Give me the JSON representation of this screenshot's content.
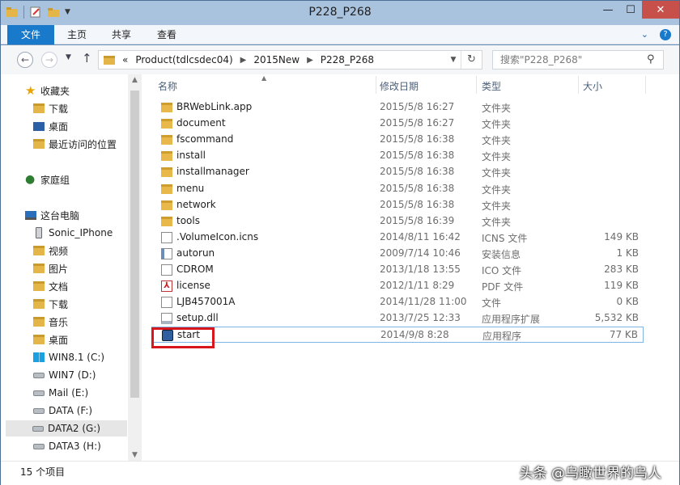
{
  "window": {
    "title": "P228_P268"
  },
  "ribbon": {
    "tabs": [
      "文件",
      "主页",
      "共享",
      "查看"
    ]
  },
  "address": {
    "overflow": "«",
    "crumbs": [
      "Product(tdlcsdec04)",
      "2015New",
      "P228_P268"
    ]
  },
  "search": {
    "placeholder": "搜索\"P228_P268\""
  },
  "nav": {
    "favorites": {
      "label": "收藏夹",
      "items": [
        "下载",
        "桌面",
        "最近访问的位置"
      ]
    },
    "homegroup": "家庭组",
    "thispc": {
      "label": "这台电脑",
      "items": [
        "Sonic_IPhone",
        "视频",
        "图片",
        "文档",
        "下载",
        "音乐",
        "桌面",
        "WIN8.1 (C:)",
        "WIN7 (D:)",
        "Mail (E:)",
        "DATA (F:)",
        "DATA2 (G:)",
        "DATA3 (H:)"
      ]
    }
  },
  "columns": {
    "name": "名称",
    "date": "修改日期",
    "type": "类型",
    "size": "大小"
  },
  "files": [
    {
      "name": "BRWebLink.app",
      "date": "2015/5/8 16:27",
      "type": "文件夹",
      "size": "",
      "icon": "folder"
    },
    {
      "name": "document",
      "date": "2015/5/8 16:27",
      "type": "文件夹",
      "size": "",
      "icon": "folder"
    },
    {
      "name": "fscommand",
      "date": "2015/5/8 16:38",
      "type": "文件夹",
      "size": "",
      "icon": "folder"
    },
    {
      "name": "install",
      "date": "2015/5/8 16:38",
      "type": "文件夹",
      "size": "",
      "icon": "folder"
    },
    {
      "name": "installmanager",
      "date": "2015/5/8 16:38",
      "type": "文件夹",
      "size": "",
      "icon": "folder"
    },
    {
      "name": "menu",
      "date": "2015/5/8 16:38",
      "type": "文件夹",
      "size": "",
      "icon": "folder"
    },
    {
      "name": "network",
      "date": "2015/5/8 16:38",
      "type": "文件夹",
      "size": "",
      "icon": "folder"
    },
    {
      "name": "tools",
      "date": "2015/5/8 16:39",
      "type": "文件夹",
      "size": "",
      "icon": "folder"
    },
    {
      "name": ".VolumeIcon.icns",
      "date": "2014/8/11 16:42",
      "type": "ICNS 文件",
      "size": "149 KB",
      "icon": "file"
    },
    {
      "name": "autorun",
      "date": "2009/7/14 10:46",
      "type": "安装信息",
      "size": "1 KB",
      "icon": "ini"
    },
    {
      "name": "CDROM",
      "date": "2013/1/18 13:55",
      "type": "ICO 文件",
      "size": "283 KB",
      "icon": "ico"
    },
    {
      "name": "license",
      "date": "2012/1/11 8:29",
      "type": "PDF 文件",
      "size": "119 KB",
      "icon": "pdf"
    },
    {
      "name": "LJB457001A",
      "date": "2014/11/28 11:00",
      "type": "文件",
      "size": "0 KB",
      "icon": "file"
    },
    {
      "name": "setup.dll",
      "date": "2013/7/25 12:33",
      "type": "应用程序扩展",
      "size": "5,532 KB",
      "icon": "dll"
    },
    {
      "name": "start",
      "date": "2014/9/8 8:28",
      "type": "应用程序",
      "size": "77 KB",
      "icon": "exe"
    }
  ],
  "status": {
    "count": "15 个项目"
  },
  "watermark": "头条 @乌瞰世界的乌人"
}
